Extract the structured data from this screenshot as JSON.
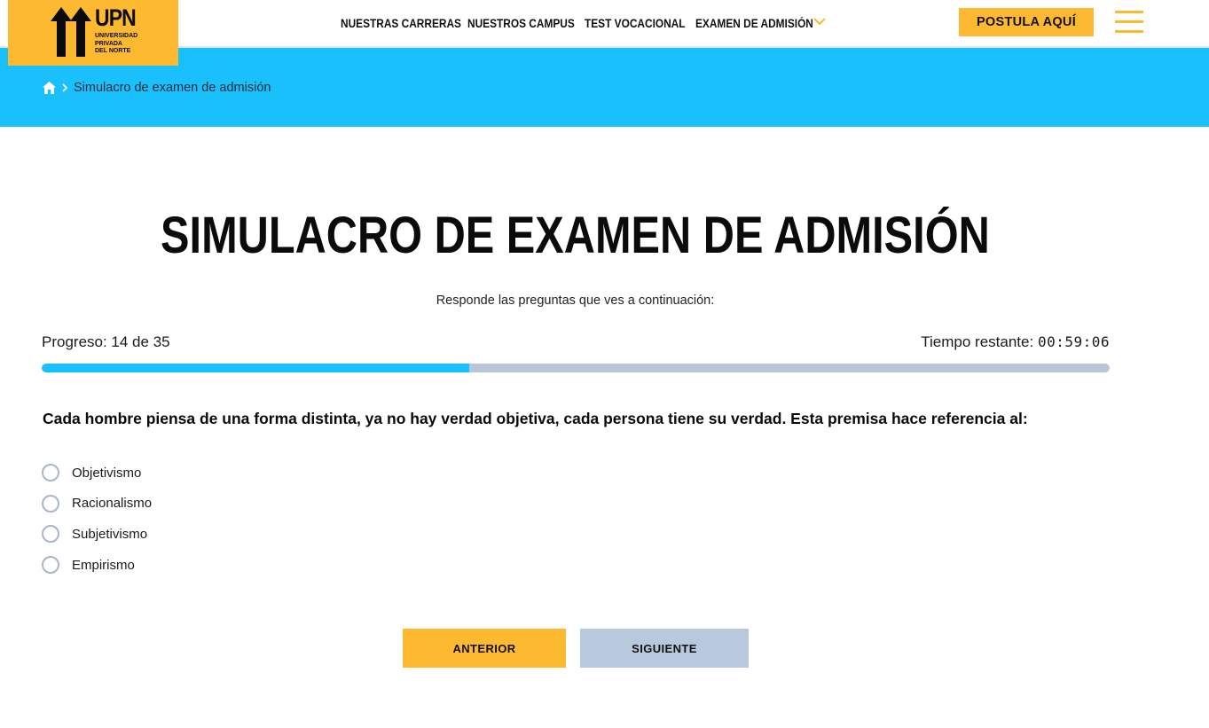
{
  "header": {
    "logo": {
      "brand": "UPN",
      "subtitle_lines": [
        "UNIVERSIDAD",
        "PRIVADA",
        "DEL NORTE"
      ]
    },
    "nav": [
      {
        "label": "NUESTRAS CARRERAS"
      },
      {
        "label": "NUESTROS CAMPUS"
      },
      {
        "label": "TEST VOCACIONAL"
      },
      {
        "label": "EXAMEN DE ADMISIÓN"
      }
    ],
    "cta_label": "POSTULA AQUÍ",
    "menu_icon": "hamburger-icon"
  },
  "breadcrumb": {
    "home_icon": "home-icon",
    "current": "Simulacro de examen de admisión"
  },
  "main": {
    "title": "SIMULACRO DE EXAMEN DE ADMISIÓN",
    "subtitle": "Responde las preguntas que ves a continuación:",
    "progress": {
      "label": "Progreso: 14 de 35",
      "current": 14,
      "total": 35,
      "fraction": 0.4
    },
    "timer": {
      "label": "Tiempo restante:",
      "value": "00:59:06"
    },
    "question": "Cada hombre piensa de una forma distinta, ya no hay verdad objetiva, cada persona tiene su verdad. Esta premisa hace referencia al:",
    "options": [
      "Objetivismo",
      "Racionalismo",
      "Subjetivismo",
      "Empirismo"
    ],
    "buttons": {
      "prev": "ANTERIOR",
      "next": "SIGUIENTE"
    }
  },
  "colors": {
    "yellow": "#fdb92f",
    "cyan": "#1ac0fb",
    "track": "#b9c6d9",
    "next_button": "#b9c9dd"
  }
}
